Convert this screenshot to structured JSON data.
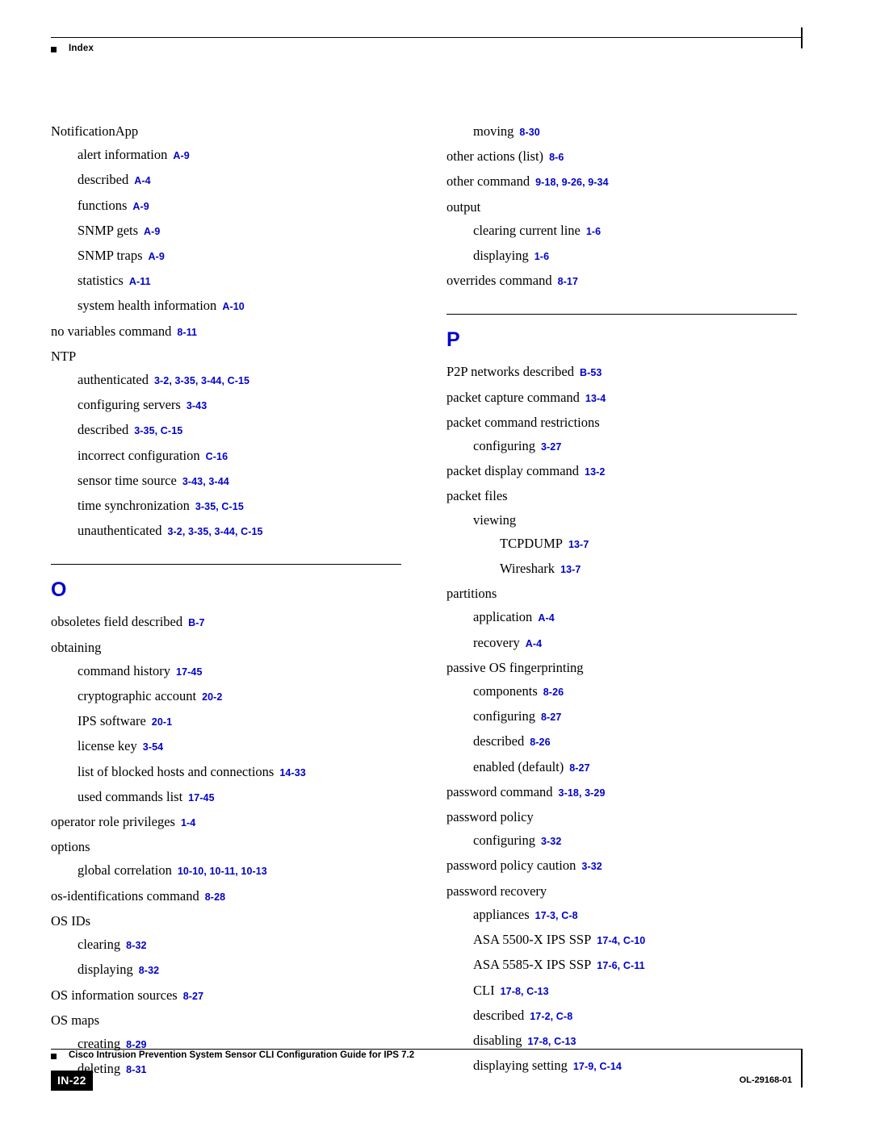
{
  "header": {
    "label": "Index"
  },
  "footer": {
    "title": "Cisco Intrusion Prevention System Sensor CLI Configuration Guide for IPS 7.2",
    "page_number": "IN-22",
    "doc_id": "OL-29168-01"
  },
  "left_column": [
    {
      "level": 0,
      "text": "NotificationApp",
      "ref": ""
    },
    {
      "level": 1,
      "text": "alert information",
      "ref": "A-9"
    },
    {
      "level": 1,
      "text": "described",
      "ref": "A-4"
    },
    {
      "level": 1,
      "text": "functions",
      "ref": "A-9"
    },
    {
      "level": 1,
      "text": "SNMP gets",
      "ref": "A-9"
    },
    {
      "level": 1,
      "text": "SNMP traps",
      "ref": "A-9"
    },
    {
      "level": 1,
      "text": "statistics",
      "ref": "A-11"
    },
    {
      "level": 1,
      "text": "system health information",
      "ref": "A-10"
    },
    {
      "level": 0,
      "text": "no variables command",
      "ref": "8-11"
    },
    {
      "level": 0,
      "text": "NTP",
      "ref": ""
    },
    {
      "level": 1,
      "text": "authenticated",
      "ref": "3-2, 3-35, 3-44, C-15"
    },
    {
      "level": 1,
      "text": "configuring servers",
      "ref": "3-43"
    },
    {
      "level": 1,
      "text": "described",
      "ref": "3-35, C-15"
    },
    {
      "level": 1,
      "text": "incorrect configuration",
      "ref": "C-16"
    },
    {
      "level": 1,
      "text": "sensor time source",
      "ref": "3-43, 3-44"
    },
    {
      "level": 1,
      "text": "time synchronization",
      "ref": "3-35, C-15"
    },
    {
      "level": 1,
      "text": "unauthenticated",
      "ref": "3-2, 3-35, 3-44, C-15"
    },
    {
      "level": "section",
      "text": "O",
      "ref": ""
    },
    {
      "level": 0,
      "text": "obsoletes field described",
      "ref": "B-7"
    },
    {
      "level": 0,
      "text": "obtaining",
      "ref": ""
    },
    {
      "level": 1,
      "text": "command history",
      "ref": "17-45"
    },
    {
      "level": 1,
      "text": "cryptographic account",
      "ref": "20-2"
    },
    {
      "level": 1,
      "text": "IPS software",
      "ref": "20-1"
    },
    {
      "level": 1,
      "text": "license key",
      "ref": "3-54"
    },
    {
      "level": 1,
      "text": "list of blocked hosts and connections",
      "ref": "14-33"
    },
    {
      "level": 1,
      "text": "used commands list",
      "ref": "17-45"
    },
    {
      "level": 0,
      "text": "operator role privileges",
      "ref": "1-4"
    },
    {
      "level": 0,
      "text": "options",
      "ref": ""
    },
    {
      "level": 1,
      "text": "global correlation",
      "ref": "10-10, 10-11, 10-13"
    },
    {
      "level": 0,
      "text": "os-identifications command",
      "ref": "8-28"
    },
    {
      "level": 0,
      "text": "OS IDs",
      "ref": ""
    },
    {
      "level": 1,
      "text": "clearing",
      "ref": "8-32"
    },
    {
      "level": 1,
      "text": "displaying",
      "ref": "8-32"
    },
    {
      "level": 0,
      "text": "OS information sources",
      "ref": "8-27"
    },
    {
      "level": 0,
      "text": "OS maps",
      "ref": ""
    },
    {
      "level": 1,
      "text": "creating",
      "ref": "8-29"
    },
    {
      "level": 1,
      "text": "deleting",
      "ref": "8-31"
    }
  ],
  "right_column": [
    {
      "level": 1,
      "text": "moving",
      "ref": "8-30"
    },
    {
      "level": 0,
      "text": "other actions (list)",
      "ref": "8-6"
    },
    {
      "level": 0,
      "text": "other command",
      "ref": "9-18, 9-26, 9-34"
    },
    {
      "level": 0,
      "text": "output",
      "ref": ""
    },
    {
      "level": 1,
      "text": "clearing current line",
      "ref": "1-6"
    },
    {
      "level": 1,
      "text": "displaying",
      "ref": "1-6"
    },
    {
      "level": 0,
      "text": "overrides command",
      "ref": "8-17"
    },
    {
      "level": "section",
      "text": "P",
      "ref": ""
    },
    {
      "level": 0,
      "text": "P2P networks described",
      "ref": "B-53"
    },
    {
      "level": 0,
      "text": "packet capture command",
      "ref": "13-4"
    },
    {
      "level": 0,
      "text": "packet command restrictions",
      "ref": ""
    },
    {
      "level": 1,
      "text": "configuring",
      "ref": "3-27"
    },
    {
      "level": 0,
      "text": "packet display command",
      "ref": "13-2"
    },
    {
      "level": 0,
      "text": "packet files",
      "ref": ""
    },
    {
      "level": 1,
      "text": "viewing",
      "ref": ""
    },
    {
      "level": 2,
      "text": "TCPDUMP",
      "ref": "13-7"
    },
    {
      "level": 2,
      "text": "Wireshark",
      "ref": "13-7"
    },
    {
      "level": 0,
      "text": "partitions",
      "ref": ""
    },
    {
      "level": 1,
      "text": "application",
      "ref": "A-4"
    },
    {
      "level": 1,
      "text": "recovery",
      "ref": "A-4"
    },
    {
      "level": 0,
      "text": "passive OS fingerprinting",
      "ref": ""
    },
    {
      "level": 1,
      "text": "components",
      "ref": "8-26"
    },
    {
      "level": 1,
      "text": "configuring",
      "ref": "8-27"
    },
    {
      "level": 1,
      "text": "described",
      "ref": "8-26"
    },
    {
      "level": 1,
      "text": "enabled (default)",
      "ref": "8-27"
    },
    {
      "level": 0,
      "text": "password command",
      "ref": "3-18, 3-29"
    },
    {
      "level": 0,
      "text": "password policy",
      "ref": ""
    },
    {
      "level": 1,
      "text": "configuring",
      "ref": "3-32"
    },
    {
      "level": 0,
      "text": "password policy caution",
      "ref": "3-32"
    },
    {
      "level": 0,
      "text": "password recovery",
      "ref": ""
    },
    {
      "level": 1,
      "text": "appliances",
      "ref": "17-3, C-8"
    },
    {
      "level": 1,
      "text": "ASA 5500-X IPS SSP",
      "ref": "17-4, C-10"
    },
    {
      "level": 1,
      "text": "ASA 5585-X IPS SSP",
      "ref": "17-6, C-11"
    },
    {
      "level": 1,
      "text": "CLI",
      "ref": "17-8, C-13"
    },
    {
      "level": 1,
      "text": "described",
      "ref": "17-2, C-8"
    },
    {
      "level": 1,
      "text": "disabling",
      "ref": "17-8, C-13"
    },
    {
      "level": 1,
      "text": "displaying setting",
      "ref": "17-9, C-14"
    }
  ]
}
